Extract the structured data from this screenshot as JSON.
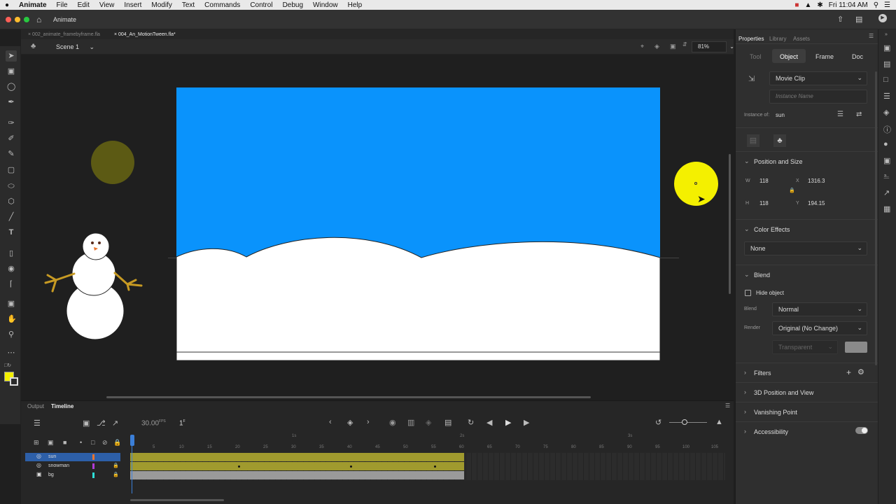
{
  "menubar": {
    "apple": "",
    "app": "Animate",
    "items": [
      "File",
      "Edit",
      "View",
      "Insert",
      "Modify",
      "Text",
      "Commands",
      "Control",
      "Debug",
      "Window",
      "Help"
    ],
    "clock": "Fri 11:04 AM"
  },
  "titlebar": {
    "app_name": "Animate"
  },
  "doc_tabs": [
    "002_animate_framebyframe.fla",
    "004_An_MotionTween.fla*"
  ],
  "editbar": {
    "scene": "Scene 1",
    "zoom": "81%"
  },
  "props": {
    "tabs": [
      "Properties",
      "Library",
      "Assets"
    ],
    "subtabs": [
      "Tool",
      "Object",
      "Frame",
      "Doc"
    ],
    "symbol_type": "Movie Clip",
    "instance_name_placeholder": "Instance Name",
    "instance_of_label": "Instance of:",
    "instance_of_value": "sun",
    "position_size": {
      "title": "Position and Size",
      "w_label": "W",
      "w": "118",
      "h_label": "H",
      "h": "118",
      "x_label": "X",
      "x": "1316.3",
      "y_label": "Y",
      "y": "194.15"
    },
    "color_effects": {
      "title": "Color Effects",
      "value": "None"
    },
    "blend": {
      "title": "Blend",
      "hide_object": "Hide object",
      "blend_label": "Blend",
      "blend_value": "Normal",
      "render_label": "Render",
      "render_value": "Original (No Change)",
      "transparent": "Transparent"
    },
    "sections": [
      "Filters",
      "3D Position and View",
      "Vanishing Point",
      "Accessibility"
    ]
  },
  "timeline": {
    "tabs": [
      "Output",
      "Timeline"
    ],
    "fps": "30.00",
    "fps_unit": "FPS",
    "frame": "1",
    "frame_unit": "F",
    "layers": [
      {
        "name": "sun",
        "color": "#e8742f"
      },
      {
        "name": "snowman",
        "color": "#b03cd8"
      },
      {
        "name": "bg",
        "color": "#2ee0d8"
      }
    ],
    "frame_numbers": [
      "5",
      "10",
      "15",
      "20",
      "25",
      "30",
      "35",
      "40",
      "45",
      "50",
      "55",
      "60",
      "65",
      "70",
      "75",
      "80",
      "85",
      "90",
      "95",
      "100",
      "105"
    ],
    "second_markers": [
      "1s",
      "2s",
      "3s"
    ]
  },
  "colors": {
    "sky": "#0a93fc",
    "sun": "#f4f000",
    "sun_offstage": "#5c5a14",
    "fill_swatch": "#f4f000",
    "tween_span": "#a09a2e",
    "selected_layer": "#2d5fa8"
  },
  "icons": [
    "apple-icon",
    "home-icon",
    "selection-tool-icon",
    "free-transform-icon",
    "lasso-icon",
    "pen-icon",
    "brush-icon",
    "pencil-icon",
    "rectangle-icon",
    "oval-icon",
    "polystar-icon",
    "line-icon",
    "text-icon",
    "eraser-icon",
    "paint-bucket-icon",
    "eyedropper-icon",
    "camera-icon",
    "hand-icon",
    "zoom-icon",
    "play-icon",
    "lock-icon",
    "eye-icon",
    "gear-icon"
  ]
}
